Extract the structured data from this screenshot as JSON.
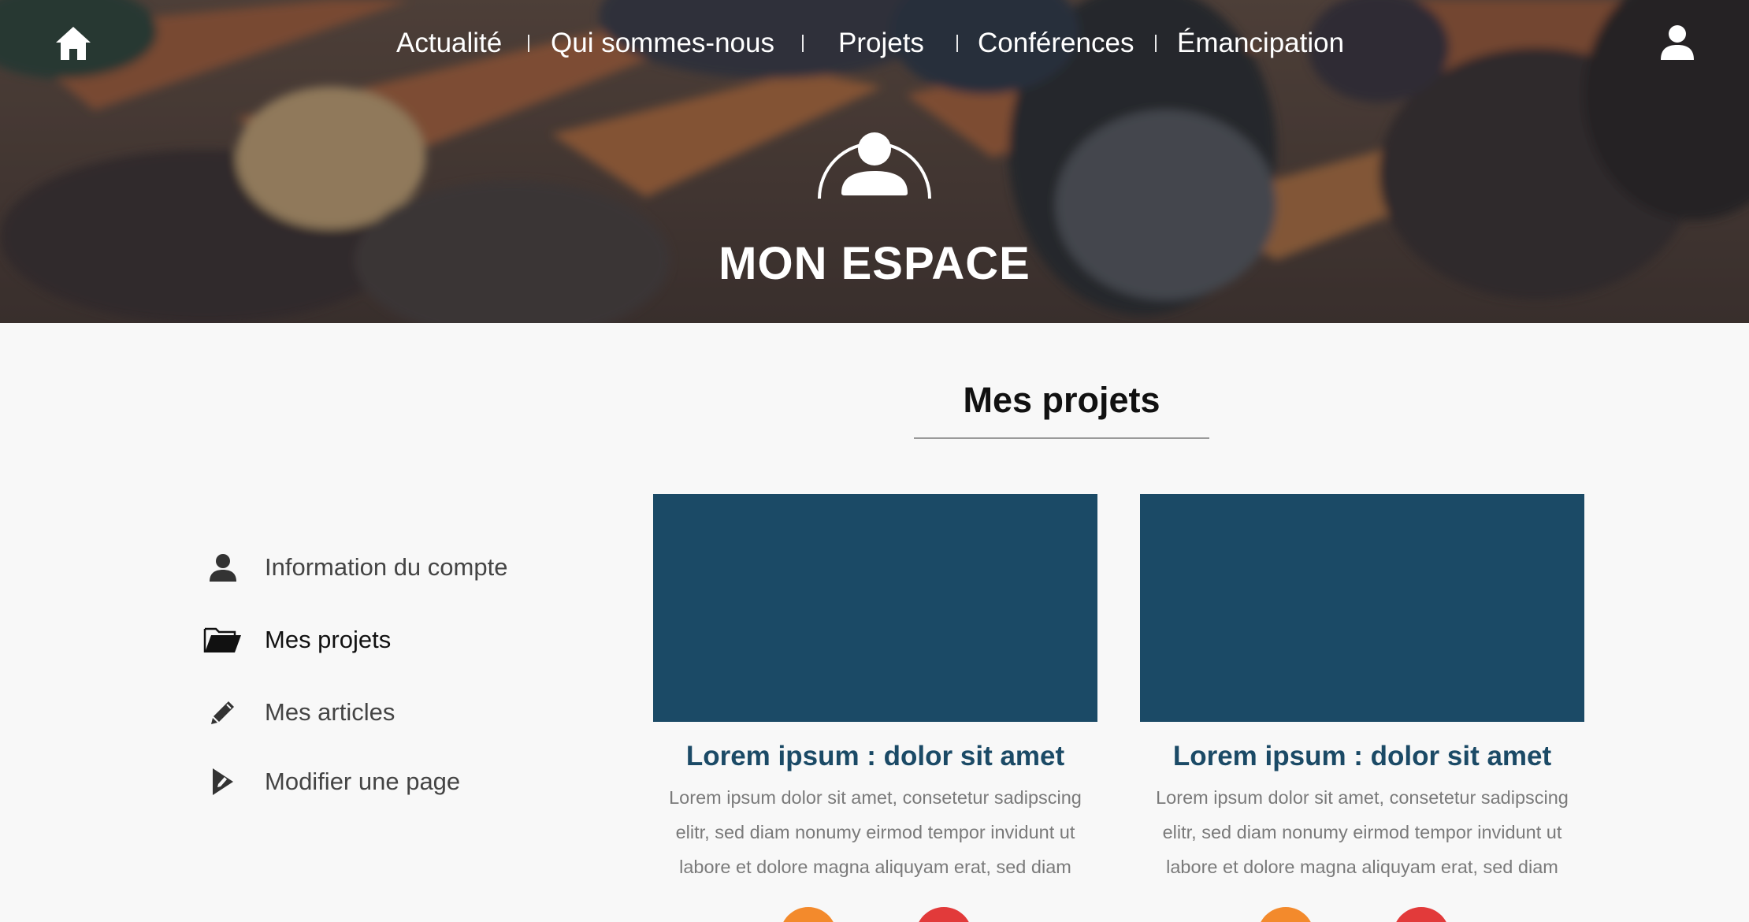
{
  "nav": {
    "items": [
      {
        "label": "Actualité"
      },
      {
        "label": "Qui sommes-nous"
      },
      {
        "label": "Projets"
      },
      {
        "label": "Conférences"
      },
      {
        "label": "Émancipation"
      }
    ]
  },
  "hero": {
    "title": "MON ESPACE"
  },
  "section": {
    "title": "Mes projets"
  },
  "sidebar": {
    "items": [
      {
        "label": "Information du compte",
        "icon": "user-icon"
      },
      {
        "label": "Mes projets",
        "icon": "folder-open-icon",
        "active": true
      },
      {
        "label": "Mes articles",
        "icon": "pencil-icon"
      },
      {
        "label": "Modifier une page",
        "icon": "page-edit-icon"
      }
    ]
  },
  "cards": [
    {
      "title": "Lorem ipsum : dolor sit amet",
      "text": "Lorem ipsum dolor sit amet, consetetur sadipscing elitr, sed diam nonumy eirmod tempor invidunt ut labore et dolore magna aliquyam erat, sed diam"
    },
    {
      "title": "Lorem ipsum : dolor sit amet",
      "text": "Lorem ipsum dolor sit amet, consetetur sadipscing elitr, sed diam nonumy eirmod tempor invidunt ut labore et dolore magna aliquyam erat, sed diam"
    }
  ],
  "colors": {
    "card_bg": "#1b4a66",
    "card_title": "#1b4a66",
    "button_orange": "#f38a2c",
    "button_red": "#e23a3a",
    "page_bg": "#f8f8f8"
  }
}
